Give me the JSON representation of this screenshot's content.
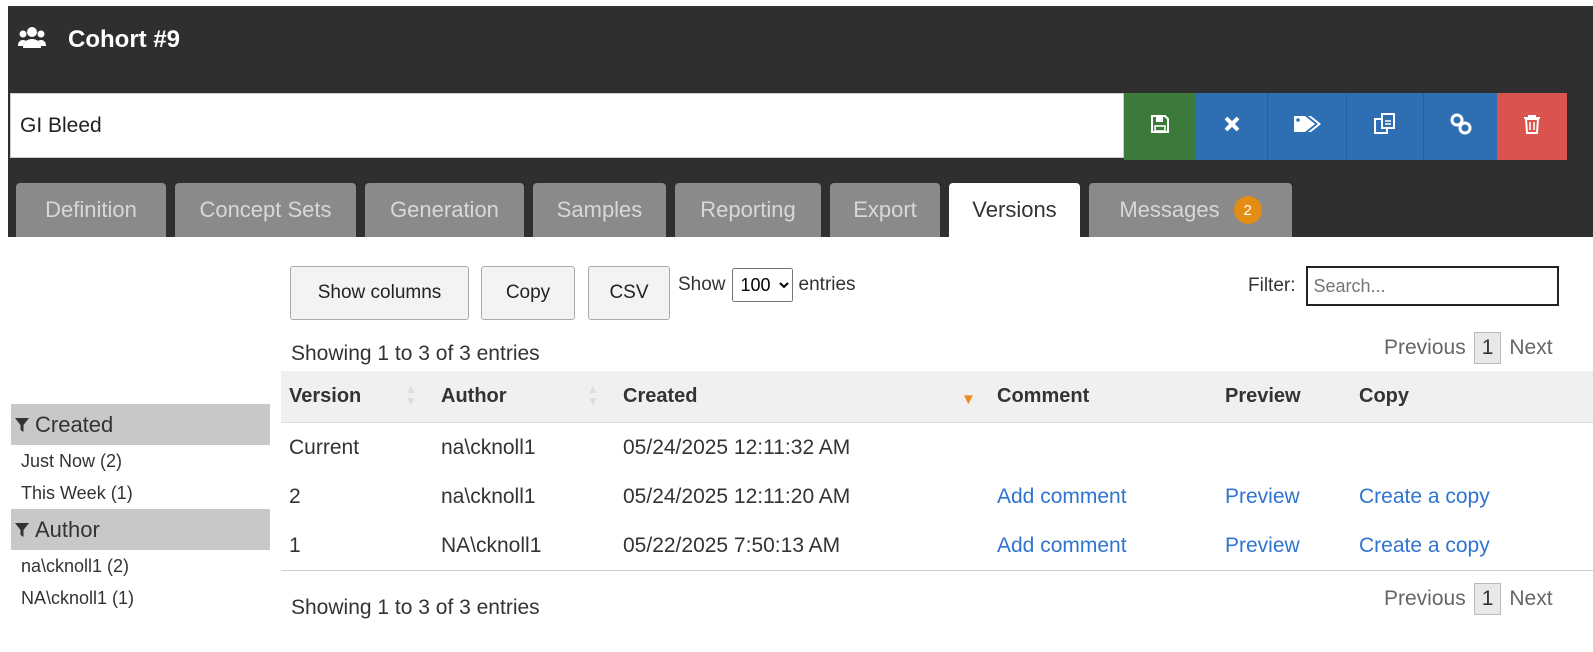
{
  "header": {
    "title": "Cohort #9",
    "cohort_name": "GI Bleed"
  },
  "toolbar": {
    "save": "save-icon",
    "close": "close-icon",
    "tags": "tags-icon",
    "copy": "copy-icon",
    "link": "link-icon",
    "delete": "trash-icon"
  },
  "tabs": [
    {
      "label": "Definition"
    },
    {
      "label": "Concept Sets"
    },
    {
      "label": "Generation"
    },
    {
      "label": "Samples"
    },
    {
      "label": "Reporting"
    },
    {
      "label": "Export"
    },
    {
      "label": "Versions",
      "active": true
    },
    {
      "label": "Messages",
      "badge": "2"
    }
  ],
  "table_controls": {
    "show_columns": "Show columns",
    "copy": "Copy",
    "csv": "CSV",
    "show": "Show",
    "length_value": "100",
    "entries": "entries",
    "filter_label": "Filter:",
    "filter_placeholder": "Search..."
  },
  "info_text": "Showing 1 to 3 of 3 entries",
  "pagination": {
    "previous": "Previous",
    "page": "1",
    "next": "Next"
  },
  "columns": [
    "Version",
    "Author",
    "Created",
    "Comment",
    "Preview",
    "Copy"
  ],
  "rows": [
    {
      "version": "Current",
      "author": "na\\cknoll1",
      "created": "05/24/2025 12:11:32 AM",
      "comment": "",
      "preview": "",
      "copy": ""
    },
    {
      "version": "2",
      "author": "na\\cknoll1",
      "created": "05/24/2025 12:11:20 AM",
      "comment": "Add comment",
      "preview": "Preview",
      "copy": "Create a copy"
    },
    {
      "version": "1",
      "author": "NA\\cknoll1",
      "created": "05/22/2025 7:50:13 AM",
      "comment": "Add comment",
      "preview": "Preview",
      "copy": "Create a copy"
    }
  ],
  "facets": {
    "created": {
      "title": "Created",
      "items": [
        "Just Now (2)",
        "This Week (1)"
      ]
    },
    "author": {
      "title": "Author",
      "items": [
        "na\\cknoll1 (2)",
        "NA\\cknoll1 (1)"
      ]
    }
  },
  "colors": {
    "header_bg": "#2f2f2f",
    "save_green": "#3b7a3b",
    "action_blue": "#2e6fb4",
    "delete_red": "#d9534f",
    "badge_orange": "#e38d13",
    "link_blue": "#2f74d1"
  }
}
